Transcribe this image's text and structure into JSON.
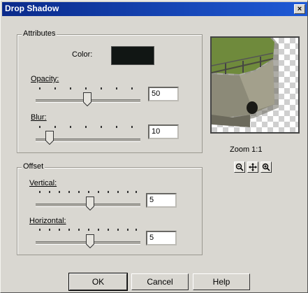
{
  "window": {
    "title": "Drop Shadow",
    "close_glyph": "×"
  },
  "attributes": {
    "group_label": "Attributes",
    "color_label": "Color:",
    "color_value": "#111614",
    "opacity_label": "Opacity:",
    "opacity_value": "50",
    "blur_label": "Blur:",
    "blur_value": "10"
  },
  "offset": {
    "group_label": "Offset",
    "vertical_label": "Vertical:",
    "vertical_value": "5",
    "horizontal_label": "Horizontal:",
    "horizontal_value": "5"
  },
  "preview": {
    "zoom_label": "Zoom 1:1",
    "zoom_out_icon": "zoom-out-icon",
    "pan_icon": "move-icon",
    "zoom_in_icon": "zoom-in-icon"
  },
  "buttons": {
    "ok": "OK",
    "cancel": "Cancel",
    "help": "Help"
  }
}
